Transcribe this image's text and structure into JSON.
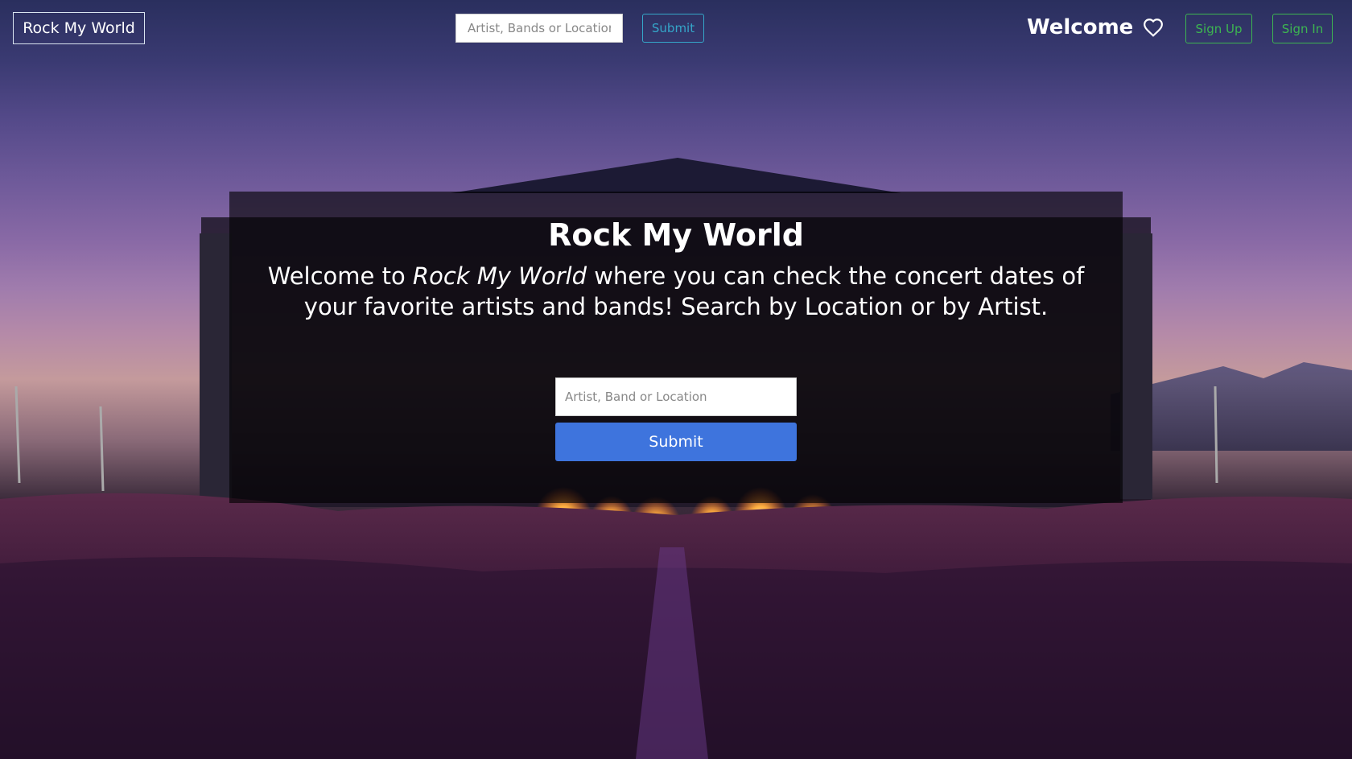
{
  "nav": {
    "brand": "Rock My World",
    "search_placeholder": "Artist, Bands or Location",
    "submit_label": "Submit",
    "welcome": "Welcome",
    "signup_label": "Sign Up",
    "signin_label": "Sign In"
  },
  "hero": {
    "title": "Rock My World",
    "text_before": "Welcome to ",
    "text_em": "Rock My World",
    "text_after": " where you can check the concert dates of your favorite artists and bands! Search by Location or by Artist.",
    "search_placeholder": "Artist, Band or Location",
    "submit_label": "Submit"
  },
  "colors": {
    "brand_border": "#d9e4f0",
    "nav_submit": "#35a6c9",
    "auth_buttons": "#3db551",
    "hero_submit": "#3e74dd"
  },
  "icons": {
    "favorites": "heart-icon"
  }
}
